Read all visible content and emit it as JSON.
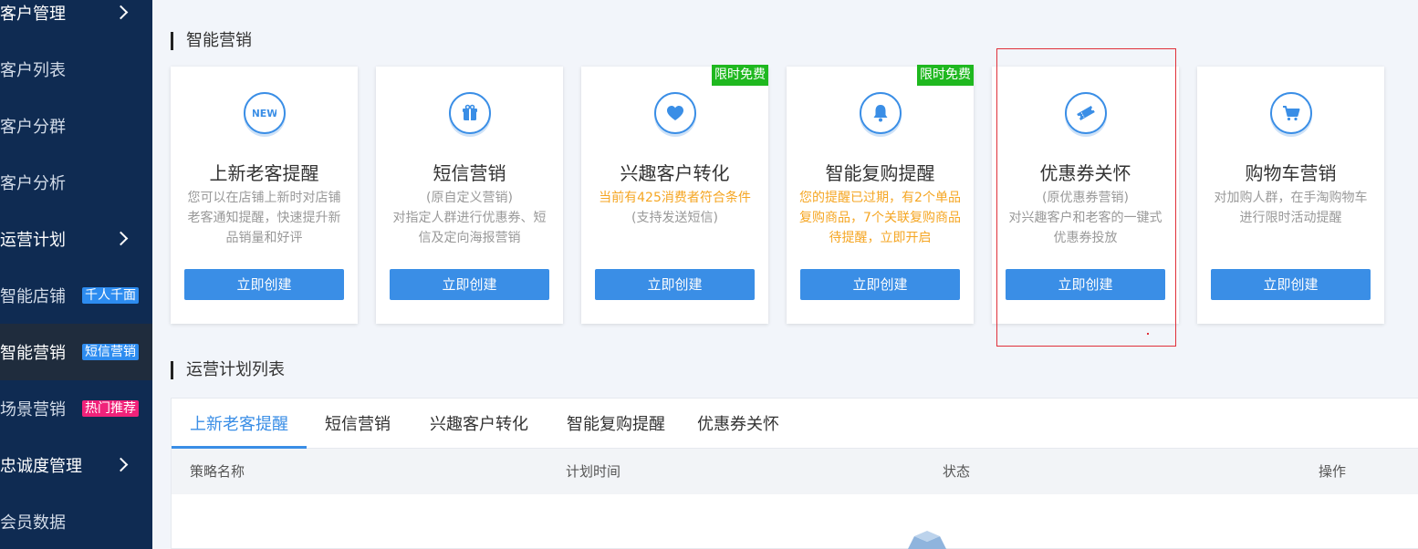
{
  "sidebar": {
    "items": [
      {
        "label": "客户管理",
        "type": "group"
      },
      {
        "label": "客户列表",
        "type": "item"
      },
      {
        "label": "客户分群",
        "type": "item"
      },
      {
        "label": "客户分析",
        "type": "item"
      },
      {
        "label": "运营计划",
        "type": "group"
      },
      {
        "label": "智能店铺",
        "type": "item",
        "badge": "千人千面",
        "badge_color": "#2d8cf0"
      },
      {
        "label": "智能营销",
        "type": "item",
        "badge": "短信营销",
        "badge_color": "#2d8cf0",
        "active": true
      },
      {
        "label": "场景营销",
        "type": "item",
        "badge": "热门推荐",
        "badge_color": "#f0227a"
      },
      {
        "label": "忠诚度管理",
        "type": "group"
      },
      {
        "label": "会员数据",
        "type": "item"
      }
    ]
  },
  "sections": {
    "smart_marketing": "智能营销",
    "plan_list": "运营计划列表"
  },
  "cards": [
    {
      "icon": "new-icon",
      "title": "上新老客提醒",
      "desc": [
        "您可以在店铺上新时对店铺老客通知提醒，快速提升新品销量和好评"
      ],
      "button": "立即创建"
    },
    {
      "icon": "gift-icon",
      "title": "短信营销",
      "desc": [
        "(原自定义营销)",
        "对指定人群进行优惠券、短信及定向海报营销"
      ],
      "button": "立即创建"
    },
    {
      "icon": "heart-icon",
      "title": "兴趣客户转化",
      "desc_orange": "当前有425消费者符合条件",
      "desc": [
        "(支持发送短信)"
      ],
      "button": "立即创建",
      "tag": "限时免费"
    },
    {
      "icon": "bell-icon",
      "title": "智能复购提醒",
      "desc_orange": "您的提醒已过期，有2个单品复购商品，7个关联复购商品待提醒，立即开启",
      "desc": [],
      "button": "立即创建",
      "tag": "限时免费"
    },
    {
      "icon": "ticket-icon",
      "title": "优惠券关怀",
      "desc": [
        "(原优惠券营销)",
        "对兴趣客户和老客的一键式优惠券投放"
      ],
      "button": "立即创建"
    },
    {
      "icon": "cart-icon",
      "title": "购物车营销",
      "desc": [
        "对加购人群，在手淘购物车进行限时活动提醒"
      ],
      "button": "立即创建"
    }
  ],
  "tabs": [
    "上新老客提醒",
    "短信营销",
    "兴趣客户转化",
    "智能复购提醒",
    "优惠券关怀"
  ],
  "active_tab": 0,
  "table_headers": [
    "策略名称",
    "计划时间",
    "状态",
    "操作"
  ],
  "colors": {
    "sidebar_bg": "#0f2b52",
    "accent": "#3a8ee6",
    "free_tag": "#1fb81f",
    "warning_text": "#f5a623"
  }
}
